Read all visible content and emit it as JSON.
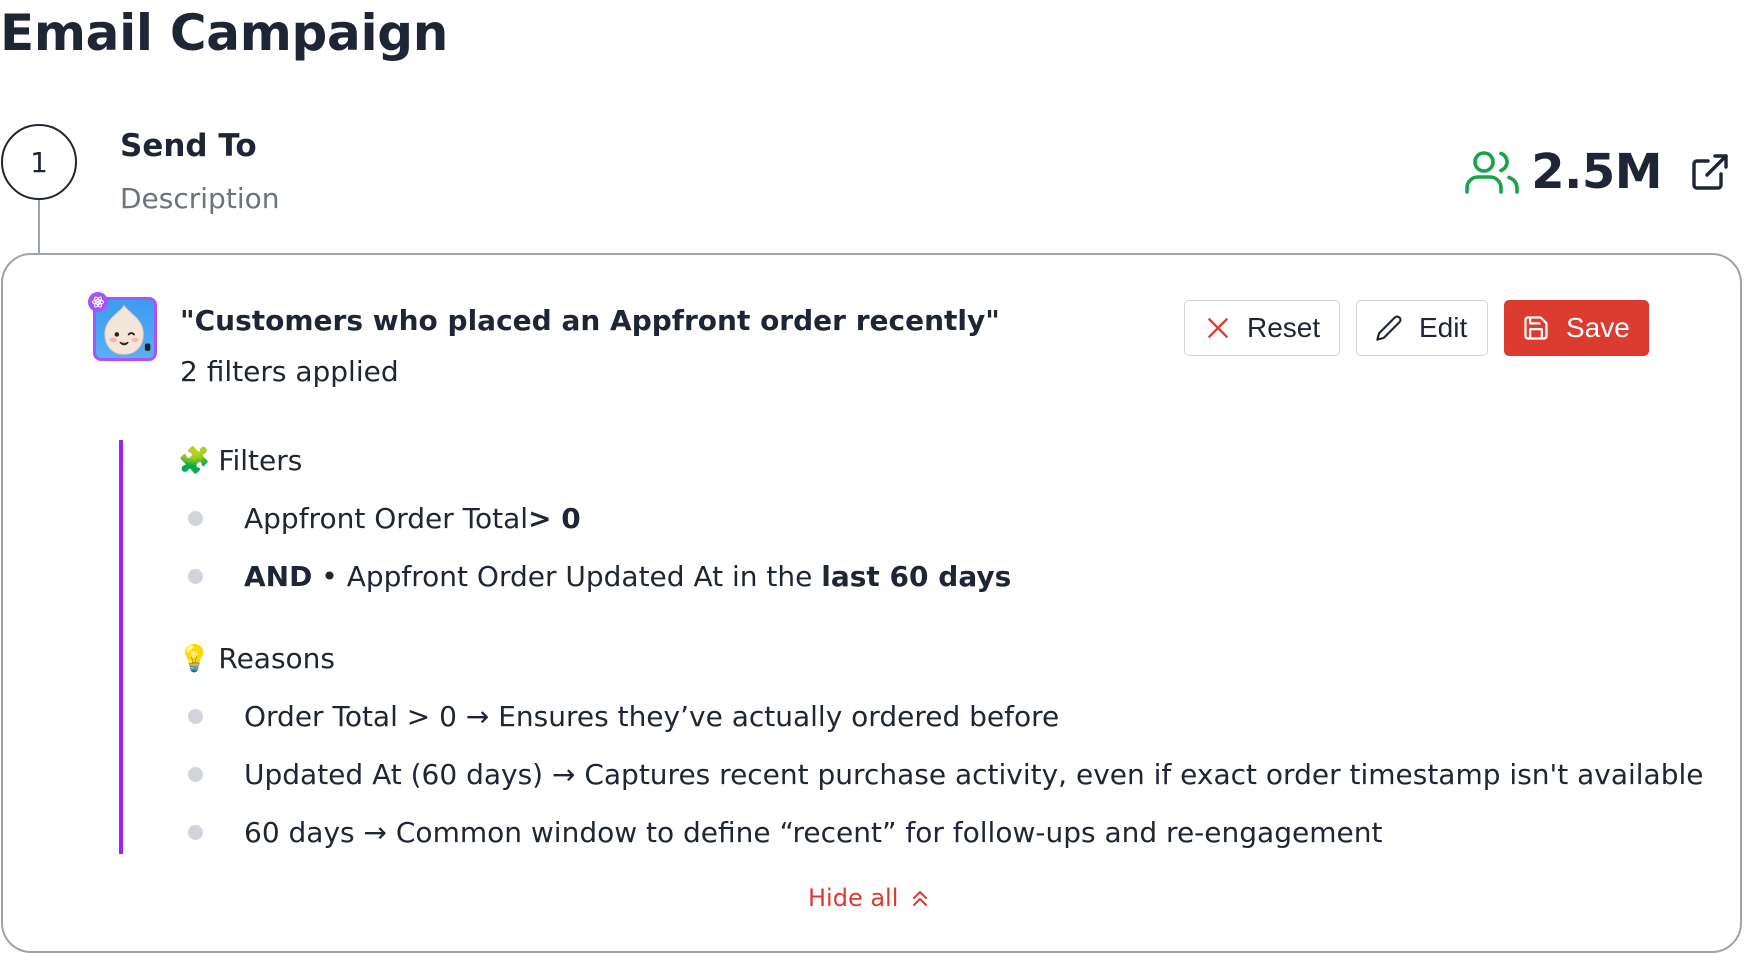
{
  "page": {
    "title": "Email Campaign"
  },
  "step": {
    "number": "1",
    "title": "Send To",
    "description": "Description",
    "audience_count": "2.5M"
  },
  "segment": {
    "name": "\"Customers who placed an Appfront order recently\"",
    "filters_applied": "2 filters applied"
  },
  "actions": {
    "reset_label": "Reset",
    "edit_label": "Edit",
    "save_label": "Save"
  },
  "filters": {
    "heading": "Filters",
    "heading_emoji": "🧩",
    "items": [
      {
        "prefix": "",
        "text": "Appfront Order Total ",
        "emphasis": "> 0"
      },
      {
        "prefix": "AND",
        "separator": " • ",
        "text": "Appfront Order Updated At in the ",
        "emphasis": "last 60 days"
      }
    ]
  },
  "reasons": {
    "heading": "Reasons",
    "heading_emoji": "💡",
    "items": [
      "Order Total > 0 → Ensures they’ve actually ordered before",
      "Updated At (60 days) → Captures recent purchase activity, even if exact order timestamp isn't available",
      "60 days → Common window to define “recent” for follow-ups and re-engagement"
    ]
  },
  "footer": {
    "hide_all_label": "Hide all"
  },
  "icons": {
    "users": "users-icon",
    "external_link": "external-link-icon",
    "reset": "close-icon",
    "edit": "pencil-icon",
    "save": "floppy-disk-icon",
    "hide_all": "chevrons-up-icon",
    "avatar_badge": "atom-icon"
  },
  "colors": {
    "accent_red": "#dc3b2f",
    "accent_purple": "#a020f0",
    "users_green": "#16a34a",
    "text_dark": "#1e2534",
    "text_muted": "#6b7280"
  }
}
